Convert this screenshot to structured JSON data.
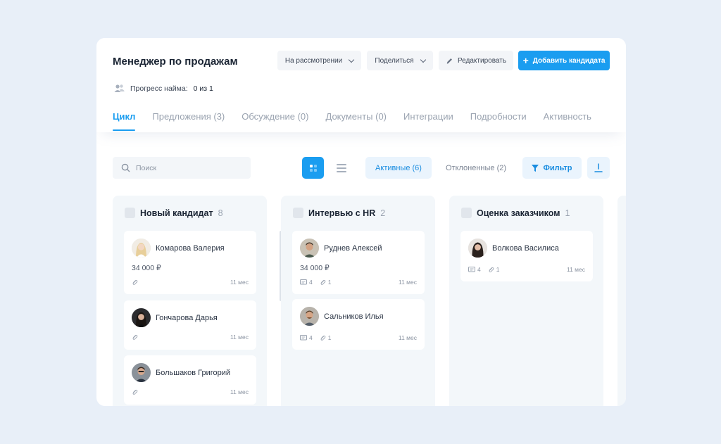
{
  "header": {
    "title": "Менеджер по продажам",
    "status_dropdown": "На рассмотрении",
    "share_dropdown": "Поделиться",
    "edit_label": "Редактировать",
    "add_label": "Добавить кандидата",
    "progress_label": "Прогресс найма:",
    "progress_value": "0 из 1"
  },
  "tabs": [
    {
      "label": "Цикл",
      "active": true
    },
    {
      "label": "Предложения (3)"
    },
    {
      "label": "Обсуждение (0)"
    },
    {
      "label": "Документы (0)"
    },
    {
      "label": "Интеграции"
    },
    {
      "label": "Подробности"
    },
    {
      "label": "Активность"
    }
  ],
  "toolbar": {
    "search_placeholder": "Поиск",
    "active_filter": "Активные (6)",
    "rejected_filter": "Отклоненные (2)",
    "filter_label": "Фильтр"
  },
  "columns": [
    {
      "title": "Новый кандидат",
      "count": "8",
      "cards": [
        {
          "name": "Комарова Валерия",
          "salary": "34 000 ₽",
          "time": "11 мес"
        },
        {
          "name": "Гончарова Дарья",
          "time": "11 мес"
        },
        {
          "name": "Большаков Григорий",
          "time": "11 мес"
        }
      ]
    },
    {
      "title": "Интервью с HR",
      "count": "2",
      "cards": [
        {
          "name": "Руднев Алексей",
          "salary": "34 000 ₽",
          "comments": "4",
          "files": "1",
          "time": "11 мес"
        },
        {
          "name": "Сальников Илья",
          "comments": "4",
          "files": "1",
          "time": "11 мес"
        }
      ]
    },
    {
      "title": "Оценка заказчиком",
      "count": "1",
      "cards": [
        {
          "name": "Волкова Василиса",
          "comments": "4",
          "files": "1",
          "time": "11 мес"
        }
      ]
    }
  ],
  "colors": {
    "accent": "#1a9df0",
    "background": "#e8eff8",
    "column": "#f3f7fa"
  }
}
